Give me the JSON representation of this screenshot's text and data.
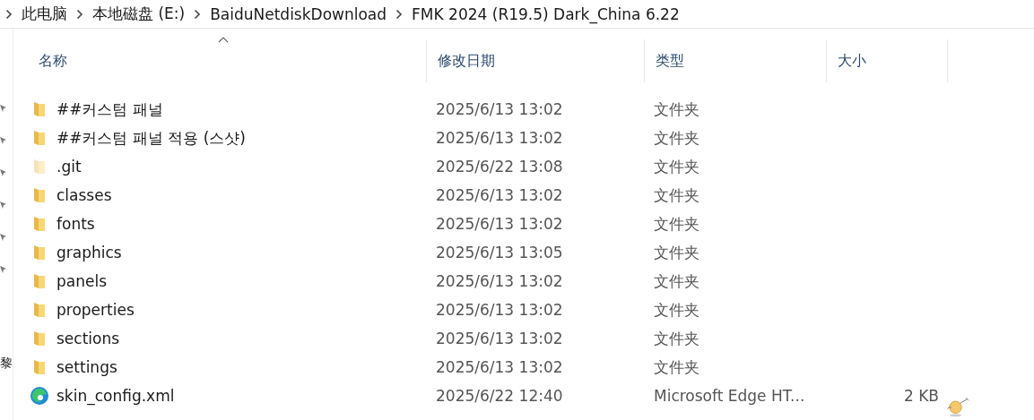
{
  "breadcrumb": [
    "此电脑",
    "本地磁盘 (E:)",
    "BaiduNetdiskDownload",
    "FMK 2024 (R19.5) Dark_China 6.22"
  ],
  "nav_pane": {
    "fragment": "黎"
  },
  "table": {
    "columns": [
      {
        "label": "名称",
        "sorted": true
      },
      {
        "label": "修改日期",
        "sorted": false
      },
      {
        "label": "类型",
        "sorted": false
      },
      {
        "label": "大小",
        "sorted": false
      }
    ],
    "rows": [
      {
        "kind": "folder",
        "hidden": false,
        "name": "##커스텀 패널",
        "date": "2025/6/13 13:02",
        "type": "文件夹"
      },
      {
        "kind": "folder",
        "hidden": false,
        "name": "##커스텀 패널 적용 (스샷)",
        "date": "2025/6/13 13:02",
        "type": "文件夹"
      },
      {
        "kind": "folder",
        "hidden": true,
        "name": ".git",
        "date": "2025/6/22 13:08",
        "type": "文件夹"
      },
      {
        "kind": "folder",
        "hidden": false,
        "name": "classes",
        "date": "2025/6/13 13:02",
        "type": "文件夹"
      },
      {
        "kind": "folder",
        "hidden": false,
        "name": "fonts",
        "date": "2025/6/13 13:02",
        "type": "文件夹"
      },
      {
        "kind": "folder",
        "hidden": false,
        "name": "graphics",
        "date": "2025/6/13 13:05",
        "type": "文件夹"
      },
      {
        "kind": "folder",
        "hidden": false,
        "name": "panels",
        "date": "2025/6/13 13:02",
        "type": "文件夹"
      },
      {
        "kind": "folder",
        "hidden": false,
        "name": "properties",
        "date": "2025/6/13 13:02",
        "type": "文件夹"
      },
      {
        "kind": "folder",
        "hidden": false,
        "name": "sections",
        "date": "2025/6/13 13:02",
        "type": "文件夹"
      },
      {
        "kind": "folder",
        "hidden": false,
        "name": "settings",
        "date": "2025/6/13 13:02",
        "type": "文件夹"
      },
      {
        "kind": "edge",
        "hidden": false,
        "name": "skin_config.xml",
        "date": "2025/6/22 12:40",
        "type": "Microsoft Edge HT...",
        "size": "2 KB"
      }
    ]
  }
}
